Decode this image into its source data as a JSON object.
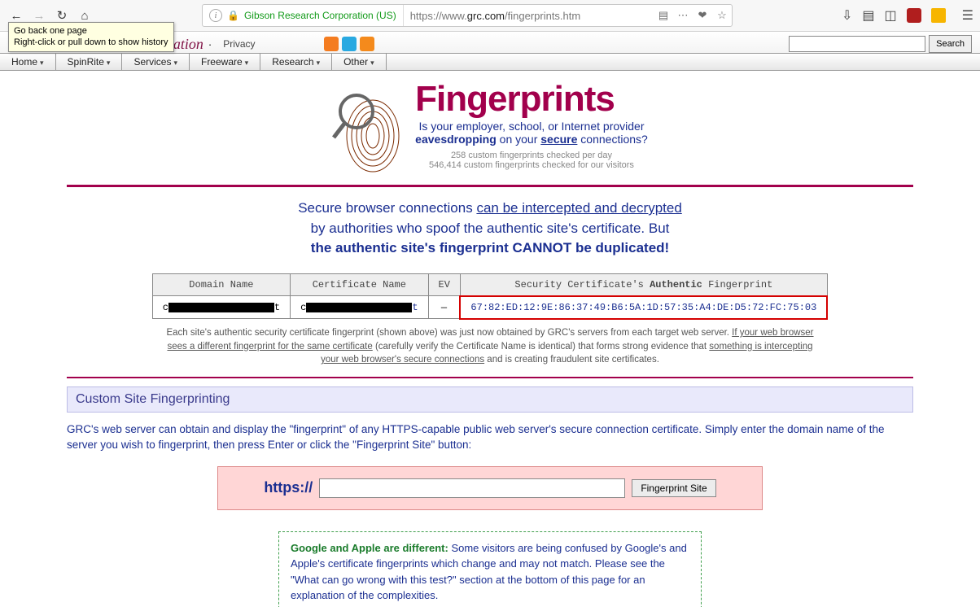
{
  "browser": {
    "tooltip_line1": "Go back one page",
    "tooltip_line2": "Right-click or pull down to show history",
    "org": "Gibson Research Corporation (US)",
    "url_proto": "https://www.",
    "url_host": "grc.com",
    "url_path": "/fingerprints.htm"
  },
  "site": {
    "title": "Gibson Research Corporation",
    "privacy": "Privacy",
    "search_btn": "Search"
  },
  "menu": {
    "home": "Home",
    "spinrite": "SpinRite",
    "services": "Services",
    "freeware": "Freeware",
    "research": "Research",
    "other": "Other"
  },
  "hero": {
    "title": "Fingerprints",
    "sub1": "Is your employer, school, or Internet provider",
    "sub_bold": "eavesdropping",
    "sub_mid": " on your ",
    "sub_secure": "secure",
    "sub_end": " connections?",
    "stat1": "258 custom fingerprints checked per day",
    "stat2": "546,414 custom fingerprints checked for our visitors"
  },
  "lead": {
    "l1a": "Secure browser connections ",
    "l1u": "can be intercepted and decrypted",
    "l2": "by authorities who spoof the authentic site's certificate. But",
    "l3": "the authentic site's fingerprint CANNOT be duplicated!"
  },
  "table": {
    "h1": "Domain Name",
    "h2": "Certificate Name",
    "h3": "EV",
    "h4a": "Security Certificate's ",
    "h4b": "Authentic",
    "h4c": " Fingerprint",
    "ev": "—",
    "fp": "67:82:ED:12:9E:86:37:49:B6:5A:1D:57:35:A4:DE:D5:72:FC:75:03"
  },
  "note": {
    "a": "Each site's authentic security certificate fingerprint (shown above) was just now obtained by GRC's servers from each target web server. ",
    "b": "If your web browser sees a different fingerprint for the same certificate",
    "c": " (carefully verify the Certificate Name is identical) that forms strong evidence that ",
    "d": "something is intercepting your web browser's secure connections",
    "e": " and is creating fraudulent site certificates."
  },
  "section": {
    "title": "Custom Site Fingerprinting"
  },
  "desc": "GRC's web server can obtain and display the \"fingerprint\" of any HTTPS-capable public web server's secure connection certificate. Simply enter the domain name of the server you wish to fingerprint, then press Enter or click the \"Fingerprint Site\" button:",
  "form": {
    "proto": "https://",
    "btn": "Fingerprint Site"
  },
  "callout": {
    "b": "Google and Apple are different:",
    "t": " Some visitors are being confused by Google's and Apple's certificate fingerprints which change and may not match.  Please see the \"What can go wrong with this test?\" section at the bottom of this page for an explanation of the complexities."
  }
}
